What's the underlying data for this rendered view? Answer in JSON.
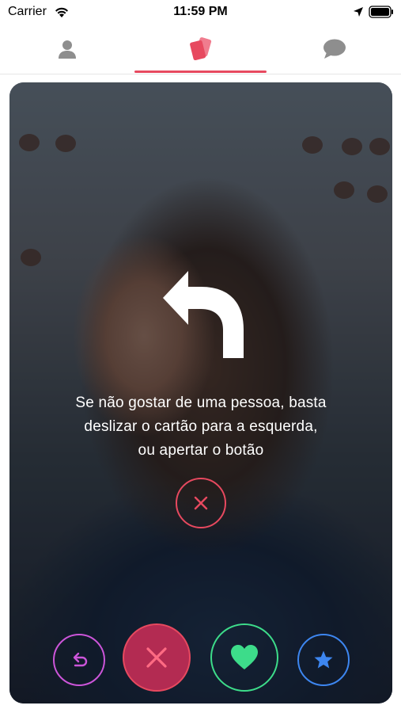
{
  "status_bar": {
    "carrier": "Carrier",
    "time": "11:59 PM",
    "icons": [
      "wifi-icon",
      "location-arrow-icon",
      "battery-icon"
    ]
  },
  "tabs": [
    {
      "name": "profile",
      "icon": "person-icon",
      "active": false
    },
    {
      "name": "cards",
      "icon": "cards-icon",
      "active": true
    },
    {
      "name": "chat",
      "icon": "chat-bubble-icon",
      "active": false
    }
  ],
  "card": {
    "photo": "woman-with-glasses-smiling",
    "hint": {
      "icon": "curved-arrow-left-icon",
      "lines": [
        "Se não gostar de uma pessoa, basta",
        "deslizar o cartão para a esquerda,",
        "ou apertar o botão"
      ],
      "button_icon": "close-icon"
    }
  },
  "actions": [
    {
      "name": "rewind",
      "icon": "rewind-icon",
      "color": "#cc55d9"
    },
    {
      "name": "dislike",
      "icon": "close-icon",
      "color": "#e7495f"
    },
    {
      "name": "like",
      "icon": "heart-icon",
      "color": "#3ddc8a"
    },
    {
      "name": "super-like",
      "icon": "star-icon",
      "color": "#3d86f0"
    }
  ],
  "colors": {
    "accent": "#e7495f",
    "tab_icon_inactive": "#8e8e8e"
  }
}
